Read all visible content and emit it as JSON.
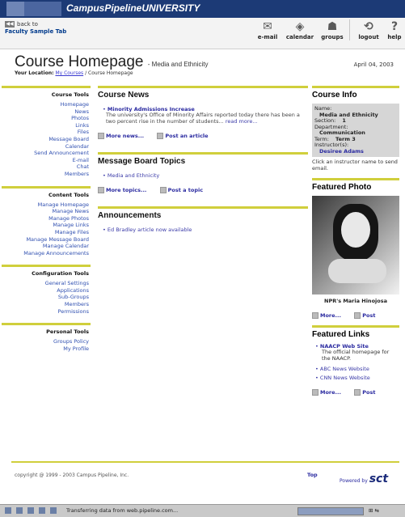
{
  "banner": {
    "brand": "CampusPipelineUNIVERSITY"
  },
  "topnav": {
    "back_line1": "back to",
    "back_line2": "Faculty Sample Tab",
    "icons": [
      {
        "label": "e-mail",
        "glyph": "✉"
      },
      {
        "label": "calendar",
        "glyph": "◈"
      },
      {
        "label": "groups",
        "glyph": "☗"
      },
      {
        "label": "logout",
        "glyph": "⟲"
      },
      {
        "label": "help",
        "glyph": "?"
      }
    ]
  },
  "page": {
    "title": "Course Homepage",
    "subtitle": "- Media and Ethnicity",
    "date": "April 04, 2003",
    "location_label": "Your Location:",
    "location_link": "My Courses",
    "location_rest": "/ Course Homepage"
  },
  "sidebar": {
    "course_tools": {
      "title": "Course Tools",
      "items": [
        "Homepage",
        "News",
        "Photos",
        "Links",
        "Files",
        "Message Board",
        "Calendar",
        "Send Announcement",
        "E-mail",
        "Chat",
        "Members"
      ]
    },
    "content_tools": {
      "title": "Content Tools",
      "items": [
        "Manage Homepage",
        "Manage News",
        "Manage Photos",
        "Manage Links",
        "Manage Files",
        "Manage Message Board",
        "Manage Calendar",
        "Manage Announcements"
      ]
    },
    "config_tools": {
      "title": "Configuration Tools",
      "items": [
        "General Settings",
        "Applications",
        "Sub-Groups",
        "Members",
        "Permissions"
      ]
    },
    "personal_tools": {
      "title": "Personal Tools",
      "items": [
        "Groups Policy",
        "My Profile"
      ]
    }
  },
  "news": {
    "title": "Course News",
    "headline": "Minority Admissions Increase",
    "body": "The university's Office of Minority Affairs reported today there has been a two percent rise in the number of students...",
    "read_more": "read more...",
    "more_link": "More news...",
    "post_link": "Post an article"
  },
  "message_board": {
    "title": "Message Board Topics",
    "topic": "Media and Ethnicity",
    "more_link": "More topics...",
    "post_link": "Post a topic"
  },
  "announcements": {
    "title": "Announcements",
    "item": "Ed Bradley article now available"
  },
  "course_info": {
    "title": "Course Info",
    "name_label": "Name:",
    "name": "Media and Ethnicity",
    "section_label": "Section:",
    "section": "1",
    "department_label": "Department:",
    "department": "Communication",
    "term_label": "Term:",
    "term": "Term 3",
    "instructor_label": "Instructor(s):",
    "instructor": "Desiree Adams",
    "note": "Click an instructor name to send email."
  },
  "featured_photo": {
    "title": "Featured Photo",
    "caption": "NPR's Maria Hinojosa",
    "more_link": "More...",
    "post_link": "Post"
  },
  "featured_links": {
    "title": "Featured Links",
    "items": [
      {
        "label": "NAACP Web Site",
        "desc": "The official homepage for the NAACP."
      },
      {
        "label": "ABC News Website",
        "desc": ""
      },
      {
        "label": "CNN News Website",
        "desc": ""
      }
    ],
    "more_link": "More...",
    "post_link": "Post"
  },
  "footer": {
    "copyright": "copyright @ 1999 - 2003 Campus Pipeline, Inc.",
    "top": "Top",
    "powered": "Powered by",
    "brand": "sct"
  },
  "statusbar": {
    "text": "Transferring data from web.pipeline.com..."
  }
}
